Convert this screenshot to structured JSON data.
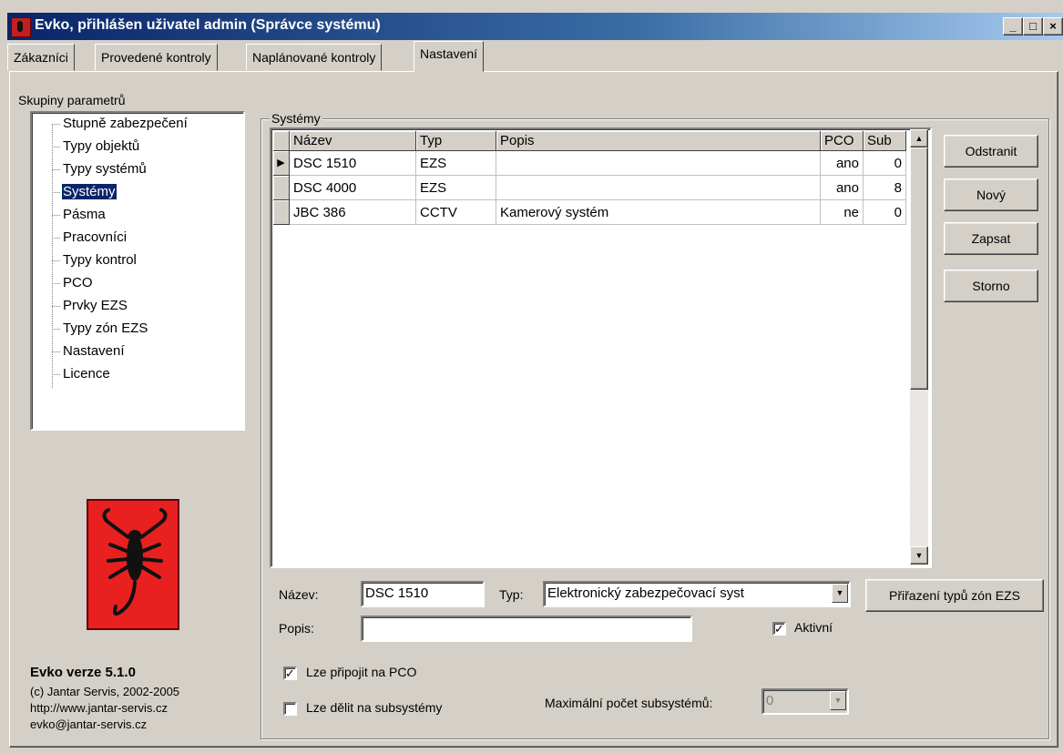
{
  "window": {
    "title": "Evko, přihlášen uživatel admin (Správce systému)",
    "min_glyph": "_",
    "max_glyph": "□",
    "close_glyph": "×"
  },
  "tabs": [
    {
      "label": "Zákazníci"
    },
    {
      "label": "Provedené kontroly"
    },
    {
      "label": "Naplánované kontroly"
    },
    {
      "label": "Nastavení",
      "active": true
    }
  ],
  "tree": {
    "label": "Skupiny parametrů",
    "items": [
      {
        "label": "Stupně zabezpečení"
      },
      {
        "label": "Typy objektů"
      },
      {
        "label": "Typy systémů"
      },
      {
        "label": "Systémy",
        "selected": true
      },
      {
        "label": "Pásma"
      },
      {
        "label": "Pracovníci"
      },
      {
        "label": "Typy kontrol"
      },
      {
        "label": "PCO"
      },
      {
        "label": "Prvky EZS"
      },
      {
        "label": "Typy zón EZS"
      },
      {
        "label": "Nastavení"
      },
      {
        "label": "Licence"
      }
    ]
  },
  "about": {
    "version": "Evko verze 5.1.0",
    "copyright": "(c) Jantar Servis, 2002-2005",
    "web": "http://www.jantar-servis.cz",
    "email": "evko@jantar-servis.cz"
  },
  "systems": {
    "group_title": "Systémy",
    "columns": [
      "Název",
      "Typ",
      "Popis",
      "PCO",
      "Sub"
    ],
    "rows": [
      [
        "DSC 1510",
        "EZS",
        "",
        "ano",
        "0"
      ],
      [
        "DSC 4000",
        "EZS",
        "",
        "ano",
        "8"
      ],
      [
        "JBC 386",
        "CCTV",
        "Kamerový systém",
        "ne",
        "0"
      ]
    ],
    "current_row_indicator": "▶"
  },
  "buttons": {
    "delete": "Odstranit",
    "new": "Nový",
    "save": "Zapsat",
    "cancel": "Storno",
    "assign_zones": "Přiřazení typů zón EZS"
  },
  "form": {
    "name_label": "Název:",
    "name_value": "DSC 1510",
    "type_label": "Typ:",
    "type_value": "Elektronický zabezpečovací syst",
    "desc_label": "Popis:",
    "desc_value": "",
    "active_label": "Aktivní",
    "active_checked": true,
    "pco_label": "Lze připojit na PCO",
    "pco_checked": true,
    "subsystems_label": "Lze dělit na subsystémy",
    "subsystems_checked": false,
    "max_sub_label": "Maximální počet subsystémů:",
    "max_sub_value": "0"
  },
  "icons": {
    "app": "scorpion-icon",
    "scroll_up": "▲",
    "scroll_down": "▼",
    "dropdown": "▼",
    "check": "✓"
  }
}
